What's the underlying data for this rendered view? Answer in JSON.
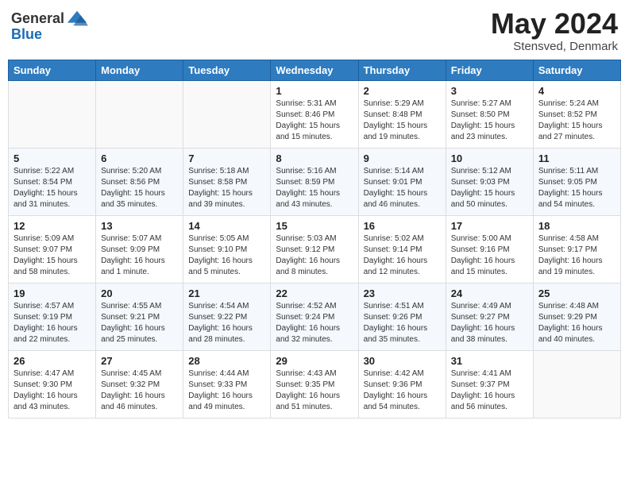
{
  "header": {
    "logo_general": "General",
    "logo_blue": "Blue",
    "month_title": "May 2024",
    "subtitle": "Stensved, Denmark"
  },
  "days_of_week": [
    "Sunday",
    "Monday",
    "Tuesday",
    "Wednesday",
    "Thursday",
    "Friday",
    "Saturday"
  ],
  "weeks": [
    [
      {
        "day": "",
        "info": ""
      },
      {
        "day": "",
        "info": ""
      },
      {
        "day": "",
        "info": ""
      },
      {
        "day": "1",
        "info": "Sunrise: 5:31 AM\nSunset: 8:46 PM\nDaylight: 15 hours\nand 15 minutes."
      },
      {
        "day": "2",
        "info": "Sunrise: 5:29 AM\nSunset: 8:48 PM\nDaylight: 15 hours\nand 19 minutes."
      },
      {
        "day": "3",
        "info": "Sunrise: 5:27 AM\nSunset: 8:50 PM\nDaylight: 15 hours\nand 23 minutes."
      },
      {
        "day": "4",
        "info": "Sunrise: 5:24 AM\nSunset: 8:52 PM\nDaylight: 15 hours\nand 27 minutes."
      }
    ],
    [
      {
        "day": "5",
        "info": "Sunrise: 5:22 AM\nSunset: 8:54 PM\nDaylight: 15 hours\nand 31 minutes."
      },
      {
        "day": "6",
        "info": "Sunrise: 5:20 AM\nSunset: 8:56 PM\nDaylight: 15 hours\nand 35 minutes."
      },
      {
        "day": "7",
        "info": "Sunrise: 5:18 AM\nSunset: 8:58 PM\nDaylight: 15 hours\nand 39 minutes."
      },
      {
        "day": "8",
        "info": "Sunrise: 5:16 AM\nSunset: 8:59 PM\nDaylight: 15 hours\nand 43 minutes."
      },
      {
        "day": "9",
        "info": "Sunrise: 5:14 AM\nSunset: 9:01 PM\nDaylight: 15 hours\nand 46 minutes."
      },
      {
        "day": "10",
        "info": "Sunrise: 5:12 AM\nSunset: 9:03 PM\nDaylight: 15 hours\nand 50 minutes."
      },
      {
        "day": "11",
        "info": "Sunrise: 5:11 AM\nSunset: 9:05 PM\nDaylight: 15 hours\nand 54 minutes."
      }
    ],
    [
      {
        "day": "12",
        "info": "Sunrise: 5:09 AM\nSunset: 9:07 PM\nDaylight: 15 hours\nand 58 minutes."
      },
      {
        "day": "13",
        "info": "Sunrise: 5:07 AM\nSunset: 9:09 PM\nDaylight: 16 hours\nand 1 minute."
      },
      {
        "day": "14",
        "info": "Sunrise: 5:05 AM\nSunset: 9:10 PM\nDaylight: 16 hours\nand 5 minutes."
      },
      {
        "day": "15",
        "info": "Sunrise: 5:03 AM\nSunset: 9:12 PM\nDaylight: 16 hours\nand 8 minutes."
      },
      {
        "day": "16",
        "info": "Sunrise: 5:02 AM\nSunset: 9:14 PM\nDaylight: 16 hours\nand 12 minutes."
      },
      {
        "day": "17",
        "info": "Sunrise: 5:00 AM\nSunset: 9:16 PM\nDaylight: 16 hours\nand 15 minutes."
      },
      {
        "day": "18",
        "info": "Sunrise: 4:58 AM\nSunset: 9:17 PM\nDaylight: 16 hours\nand 19 minutes."
      }
    ],
    [
      {
        "day": "19",
        "info": "Sunrise: 4:57 AM\nSunset: 9:19 PM\nDaylight: 16 hours\nand 22 minutes."
      },
      {
        "day": "20",
        "info": "Sunrise: 4:55 AM\nSunset: 9:21 PM\nDaylight: 16 hours\nand 25 minutes."
      },
      {
        "day": "21",
        "info": "Sunrise: 4:54 AM\nSunset: 9:22 PM\nDaylight: 16 hours\nand 28 minutes."
      },
      {
        "day": "22",
        "info": "Sunrise: 4:52 AM\nSunset: 9:24 PM\nDaylight: 16 hours\nand 32 minutes."
      },
      {
        "day": "23",
        "info": "Sunrise: 4:51 AM\nSunset: 9:26 PM\nDaylight: 16 hours\nand 35 minutes."
      },
      {
        "day": "24",
        "info": "Sunrise: 4:49 AM\nSunset: 9:27 PM\nDaylight: 16 hours\nand 38 minutes."
      },
      {
        "day": "25",
        "info": "Sunrise: 4:48 AM\nSunset: 9:29 PM\nDaylight: 16 hours\nand 40 minutes."
      }
    ],
    [
      {
        "day": "26",
        "info": "Sunrise: 4:47 AM\nSunset: 9:30 PM\nDaylight: 16 hours\nand 43 minutes."
      },
      {
        "day": "27",
        "info": "Sunrise: 4:45 AM\nSunset: 9:32 PM\nDaylight: 16 hours\nand 46 minutes."
      },
      {
        "day": "28",
        "info": "Sunrise: 4:44 AM\nSunset: 9:33 PM\nDaylight: 16 hours\nand 49 minutes."
      },
      {
        "day": "29",
        "info": "Sunrise: 4:43 AM\nSunset: 9:35 PM\nDaylight: 16 hours\nand 51 minutes."
      },
      {
        "day": "30",
        "info": "Sunrise: 4:42 AM\nSunset: 9:36 PM\nDaylight: 16 hours\nand 54 minutes."
      },
      {
        "day": "31",
        "info": "Sunrise: 4:41 AM\nSunset: 9:37 PM\nDaylight: 16 hours\nand 56 minutes."
      },
      {
        "day": "",
        "info": ""
      }
    ]
  ]
}
